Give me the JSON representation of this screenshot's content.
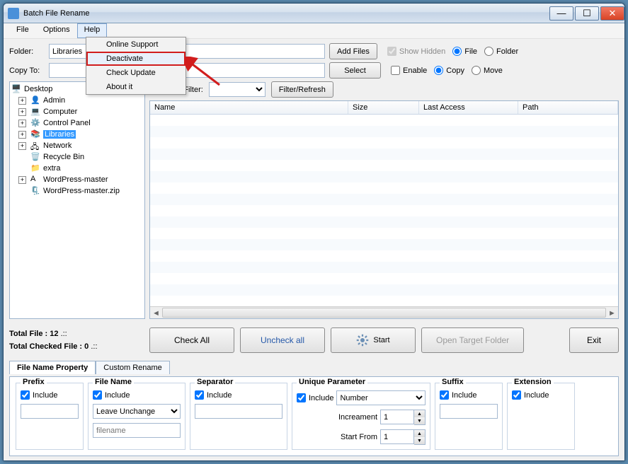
{
  "window": {
    "title": "Batch File Rename"
  },
  "menu": {
    "file": "File",
    "options": "Options",
    "help": "Help"
  },
  "help_menu": {
    "online_support": "Online Support",
    "deactivate": "Deactivate",
    "check_update": "Check Update",
    "about": "About it"
  },
  "folder": {
    "label": "Folder:",
    "value": "Libraries",
    "add_files": "Add Files",
    "show_hidden": "Show Hidden",
    "file": "File",
    "folder_radio": "Folder"
  },
  "copy": {
    "label": "Copy To:",
    "value": "",
    "select": "Select",
    "enable": "Enable",
    "copy_radio": "Copy",
    "move_radio": "Move"
  },
  "filter": {
    "label": "Filename Filter:",
    "refresh": "Filter/Refresh"
  },
  "grid": {
    "name": "Name",
    "size": "Size",
    "last_access": "Last Access",
    "path": "Path"
  },
  "tree": {
    "root": "Desktop",
    "items": [
      {
        "label": "Admin",
        "exp": "+",
        "icon": "user"
      },
      {
        "label": "Computer",
        "exp": "+",
        "icon": "computer"
      },
      {
        "label": "Control Panel",
        "exp": "+",
        "icon": "cpanel"
      },
      {
        "label": "Libraries",
        "exp": "+",
        "icon": "libraries",
        "selected": true
      },
      {
        "label": "Network",
        "exp": "+",
        "icon": "network"
      },
      {
        "label": "Recycle Bin",
        "exp": "",
        "icon": "recycle"
      },
      {
        "label": "extra",
        "exp": "",
        "icon": "folder"
      },
      {
        "label": "WordPress-master",
        "exp": "+",
        "icon": "A"
      },
      {
        "label": "WordPress-master.zip",
        "exp": "",
        "icon": "zip"
      }
    ]
  },
  "stats": {
    "total_file_label": "Total File :",
    "total_file_value": "12",
    "total_checked_label": "Total Checked File :",
    "total_checked_value": "0",
    "dots": ".::"
  },
  "actions": {
    "check_all": "Check All",
    "uncheck_all": "Uncheck all",
    "start": "Start",
    "open_target": "Open Target Folder",
    "exit": "Exit"
  },
  "tabs": {
    "file_prop": "File Name Property",
    "custom": "Custom Rename"
  },
  "prop": {
    "prefix": {
      "title": "Prefix",
      "include": "Include",
      "value": ""
    },
    "filename": {
      "title": "File Name",
      "include": "Include",
      "mode": "Leave Unchange",
      "placeholder": "filename"
    },
    "separator": {
      "title": "Separator",
      "include": "Include",
      "value": ""
    },
    "unique": {
      "title": "Unique Parameter",
      "include": "Include",
      "type": "Number",
      "increment_label": "Increament",
      "increment": "1",
      "start_label": "Start From",
      "start": "1"
    },
    "suffix": {
      "title": "Suffix",
      "include": "Include",
      "value": ""
    },
    "extension": {
      "title": "Extension",
      "include": "Include"
    }
  }
}
